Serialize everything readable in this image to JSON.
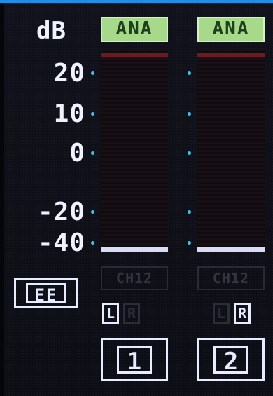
{
  "header": {
    "db_label": "dB"
  },
  "scale": [
    "20",
    "10",
    "0",
    "-20",
    "-40"
  ],
  "meters": [
    {
      "name": "channel-1",
      "source_badge": "ANA",
      "ghost_label": "CH12",
      "lr_left": "L",
      "lr_right": "R",
      "channel_number": "1"
    },
    {
      "name": "channel-2",
      "source_badge": "ANA",
      "ghost_label": "CH12",
      "lr_left": "L",
      "lr_right": "R",
      "channel_number": "2"
    }
  ],
  "mode_button": {
    "label": "EE"
  },
  "colors": {
    "accent": "#1e8fe6",
    "ana_badge": "#a6d98a",
    "tick_dots": "#39c7e8",
    "peak": "#6a1b21"
  }
}
